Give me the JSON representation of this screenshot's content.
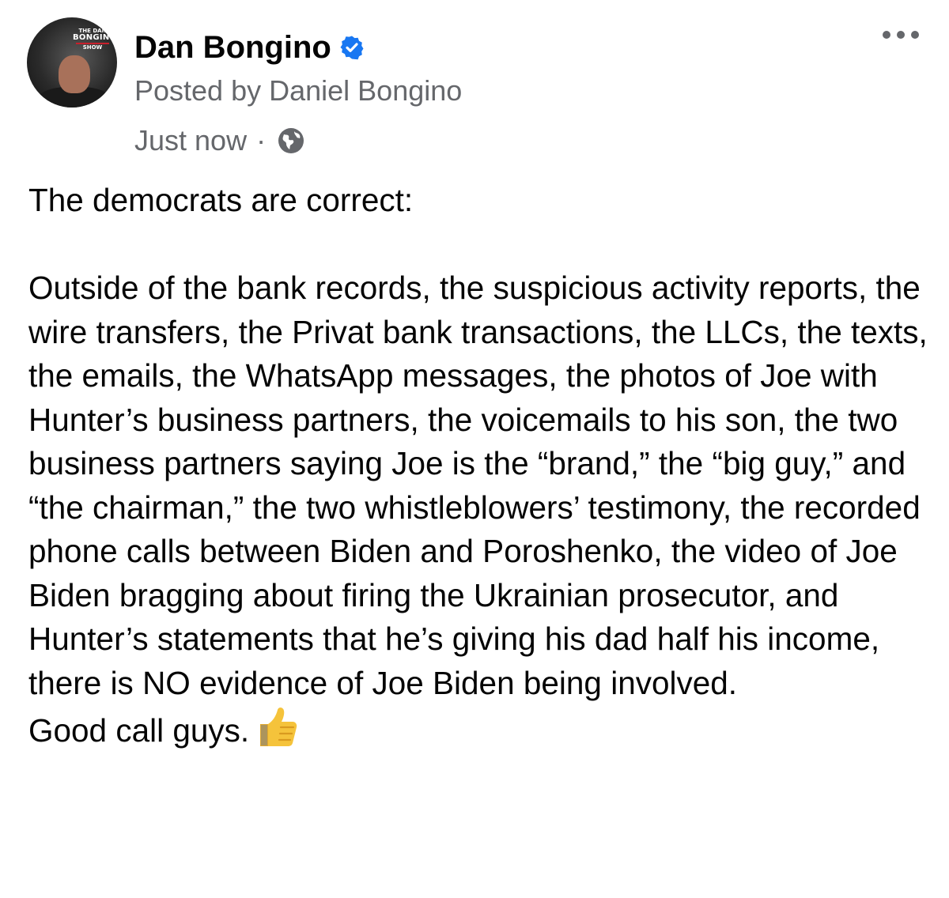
{
  "post": {
    "author_name": "Dan Bongino",
    "verified_icon": "verified-badge-icon",
    "posted_by": "Posted by Daniel Bongino",
    "timestamp": "Just now",
    "separator": "·",
    "audience_icon": "globe-icon",
    "more_icon": "more-options-icon",
    "avatar_logo": {
      "line1": "THE DAN",
      "line2": "BONGINO",
      "line3": "SHOW"
    },
    "body": {
      "line_intro": "The democrats are correct:",
      "paragraph": "Outside of the bank records, the suspicious activity reports, the wire transfers, the Privat bank transactions, the LLCs, the texts, the emails, the WhatsApp messages, the photos of Joe with Hunter’s business partners, the voicemails to his son, the two business partners saying Joe is the “brand,” the “big guy,” and “the chairman,” the two whistleblowers’ testimony, the recorded phone calls between Biden and Poroshenko, the video of Joe Biden bragging about firing the Ukrainian prosecutor, and Hunter’s statements that he’s giving his dad half his income, there is NO evidence of Joe Biden being involved.",
      "closing": "Good call guys.",
      "emoji_icon": "thumbs-up-icon"
    }
  },
  "colors": {
    "text_primary": "#050505",
    "text_secondary": "#65676b",
    "verified_blue": "#1877f2",
    "emoji_yellow": "#f5c33b"
  }
}
